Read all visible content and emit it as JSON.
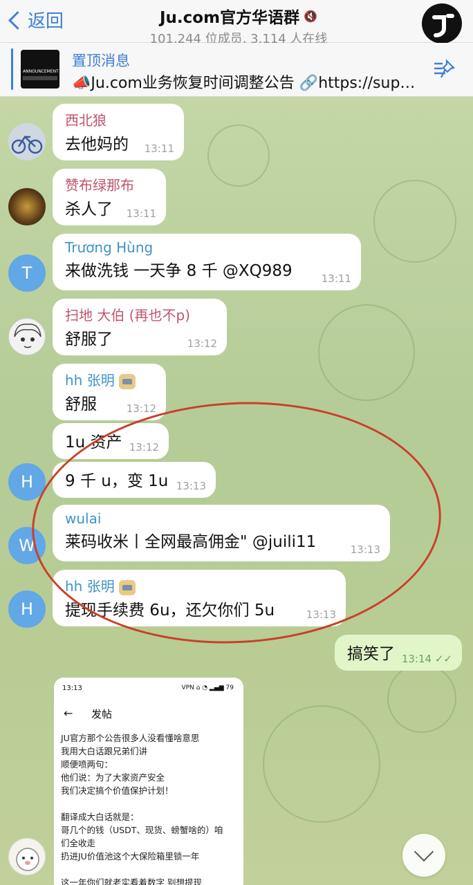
{
  "header": {
    "back_label": "返回",
    "title": "Ju.com官方华语群",
    "subtitle": "101,244 位成员, 3,114 人在线"
  },
  "pinned": {
    "label": "置顶消息",
    "text": "📣Ju.com业务恢复时间调整公告 🔗https://sup…",
    "thumb_caption": "ANNOUNCEMENT"
  },
  "messages": [
    {
      "sender": "西北狼",
      "text": "去他妈的",
      "time": "13:11",
      "sender_color": "#c0546a"
    },
    {
      "sender": "赞布绿那布",
      "text": "杀人了",
      "time": "13:11",
      "sender_color": "#c0546a"
    },
    {
      "sender": "Trương Hùng",
      "text": "来做洗钱 一天争 8 千 @XQ989",
      "time": "13:11",
      "sender_color": "#3d94c8",
      "avatar_letter": "T"
    },
    {
      "sender": "扫地 大伯 (再也不p)",
      "text": "舒服了",
      "time": "13:12",
      "sender_color": "#c0546a"
    },
    {
      "sender": "hh 张明",
      "text": "舒服",
      "time": "13:12",
      "sender_color": "#3d94c8"
    },
    {
      "sender": "",
      "text": "1u 资产",
      "time": "13:12"
    },
    {
      "sender": "",
      "text": "9 千 u，变 1u",
      "time": "13:13",
      "avatar_letter": "H"
    },
    {
      "sender": "wulai",
      "text": "莱码收米丨全网最高佣金\" @juili11",
      "time": "13:13",
      "sender_color": "#3d94c8",
      "avatar_letter": "W"
    },
    {
      "sender": "hh 张明",
      "text": "提现手续费 6u，还欠你们 5u",
      "time": "13:13",
      "sender_color": "#3d94c8",
      "avatar_letter": "H"
    },
    {
      "sender": "",
      "text": "搞笑了",
      "time": "13:14"
    }
  ],
  "card": {
    "status_time": "13:13",
    "status_right": "VPN ⌂ ◔ ▂▄▆ 79",
    "back_glyph": "←",
    "title": "发帖",
    "body": "JU官方那个公告很多人没看懂啥意思\n我用大白话跟兄弟们讲\n顺便喷两句：\n他们说：为了大家资产安全\n我们决定搞个价值保护计划！\n\n翻译成大白话就是：\n哥几个的钱（USDT、现货、螃蟹啥的）咱\n们全收走\n扔进JU价值池这个大保险箱里锁一年\n\n这一年你们就老实看着数字 别想提现"
  },
  "colors": {
    "accent": "#3d7fd6",
    "outgoing_bubble": "#e1f5c9",
    "annotation_circle": "#c8402a"
  }
}
